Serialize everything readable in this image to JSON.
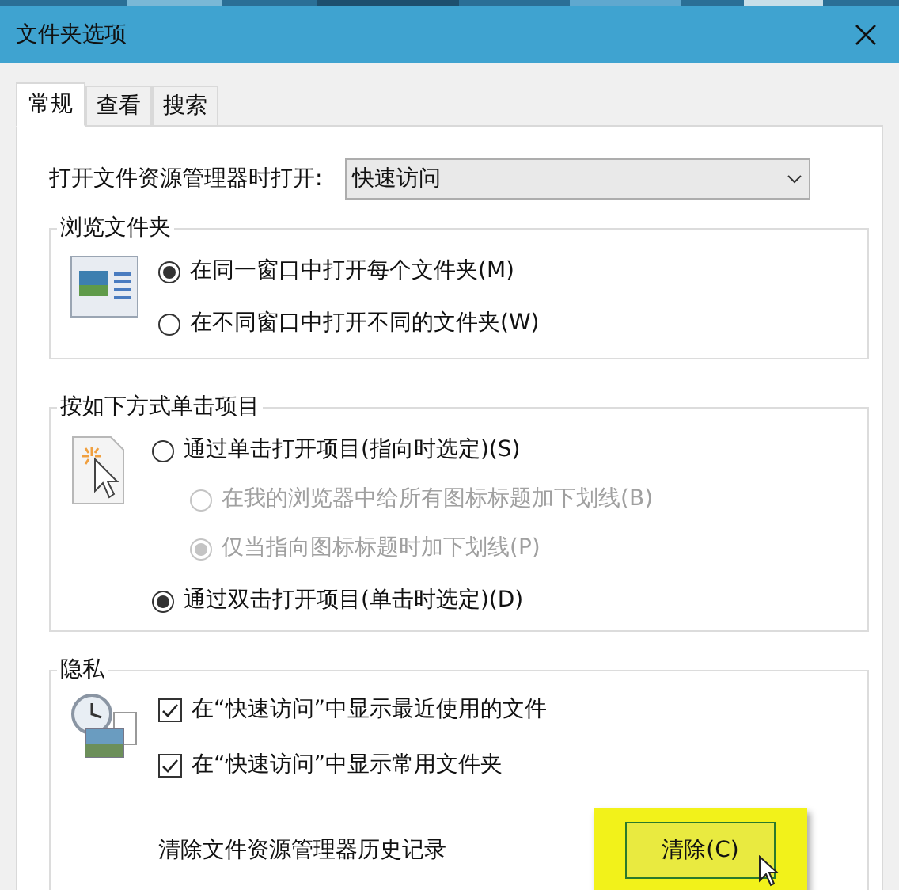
{
  "window": {
    "title": "文件夹选项"
  },
  "tabs": [
    {
      "label": "常规",
      "selected": true
    },
    {
      "label": "查看",
      "selected": false
    },
    {
      "label": "搜索",
      "selected": false
    }
  ],
  "open_with": {
    "label": "打开文件资源管理器时打开:",
    "value": "快速访问"
  },
  "groups": [
    {
      "title": "浏览文件夹",
      "options": [
        {
          "kind": "radio",
          "label": "在同一窗口中打开每个文件夹(M)",
          "selected": true,
          "disabled": false
        },
        {
          "kind": "radio",
          "label": "在不同窗口中打开不同的文件夹(W)",
          "selected": false,
          "disabled": false
        }
      ]
    },
    {
      "title": "按如下方式单击项目",
      "options": [
        {
          "kind": "radio",
          "label": "通过单击打开项目(指向时选定)(S)",
          "selected": false,
          "disabled": false,
          "children": [
            {
              "kind": "radio",
              "label": "在我的浏览器中给所有图标标题加下划线(B)",
              "selected": false,
              "disabled": true
            },
            {
              "kind": "radio",
              "label": "仅当指向图标标题时加下划线(P)",
              "selected": true,
              "disabled": true
            }
          ]
        },
        {
          "kind": "radio",
          "label": "通过双击打开项目(单击时选定)(D)",
          "selected": true,
          "disabled": false
        }
      ]
    },
    {
      "title": "隐私",
      "options": [
        {
          "kind": "checkbox",
          "label": "在“快速访问”中显示最近使用的文件",
          "checked": true
        },
        {
          "kind": "checkbox",
          "label": "在“快速访问”中显示常用文件夹",
          "checked": true
        },
        {
          "kind": "action",
          "label": "清除文件资源管理器历史记录",
          "button": "清除(C)",
          "highlighted": true
        }
      ]
    }
  ]
}
